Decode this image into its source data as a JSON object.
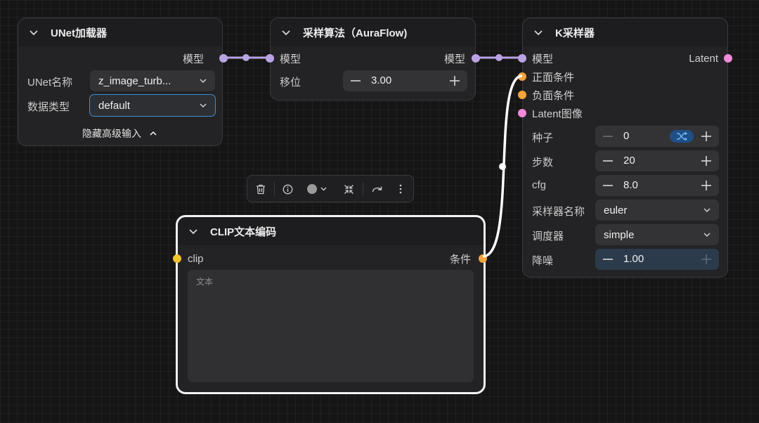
{
  "colors": {
    "canvas": "#151515",
    "node_bg": "#232325",
    "model_link": "#b9a3e3",
    "conditioning": "#f5a53b",
    "latent": "#f08ad9",
    "clip": "#f2c230",
    "focus": "#3b8fd9"
  },
  "icons": [
    "chevron-down-icon",
    "chevron-up-icon",
    "minus-icon",
    "plus-icon",
    "shuffle-icon",
    "trash-icon",
    "info-icon",
    "color-dot-icon",
    "collapse-icon",
    "redo-icon",
    "more-vertical-icon"
  ],
  "unet_loader": {
    "title": "UNet加载器",
    "output_model": "模型",
    "unet_name_label": "UNet名称",
    "unet_name_value": "z_image_turb...",
    "dtype_label": "数据类型",
    "dtype_value": "default",
    "advanced_toggle": "隐藏高级输入"
  },
  "sampling_algo": {
    "title": "采样算法（AuraFlow)",
    "input_model": "模型",
    "output_model": "模型",
    "shift_label": "移位",
    "shift_value": "3.00"
  },
  "ksampler": {
    "title": "K采样器",
    "input_model": "模型",
    "input_positive": "正面条件",
    "input_negative": "负面条件",
    "input_latent": "Latent图像",
    "output_latent": "Latent",
    "seed_label": "种子",
    "seed_value": "0",
    "steps_label": "步数",
    "steps_value": "20",
    "cfg_label": "cfg",
    "cfg_value": "8.0",
    "sampler_label": "采样器名称",
    "sampler_value": "euler",
    "scheduler_label": "调度器",
    "scheduler_value": "simple",
    "denoise_label": "降噪",
    "denoise_value": "1.00"
  },
  "clip_encode": {
    "title": "CLIP文本编码",
    "input_clip": "clip",
    "output_conditioning": "条件",
    "text_placeholder": "文本"
  }
}
